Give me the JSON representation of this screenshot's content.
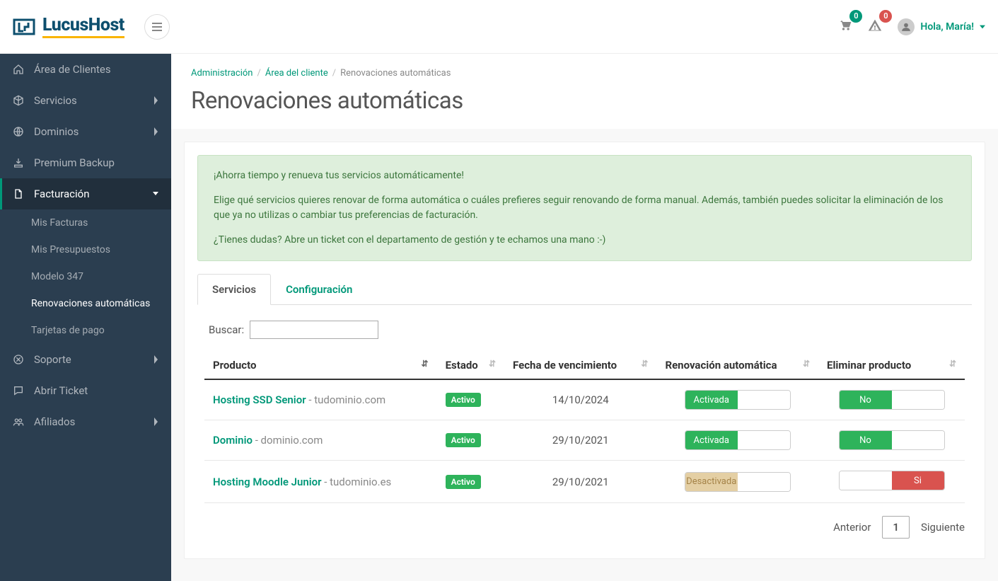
{
  "header": {
    "logo_text": "LucusHost",
    "cart_count": "0",
    "alert_count": "0",
    "greeting": "Hola, María!"
  },
  "sidebar": {
    "items": [
      {
        "label": "Área de Clientes",
        "icon": "home"
      },
      {
        "label": "Servicios",
        "icon": "cube",
        "chevron": true
      },
      {
        "label": "Dominios",
        "icon": "globe",
        "chevron": true
      },
      {
        "label": "Premium Backup",
        "icon": "download"
      },
      {
        "label": "Facturación",
        "icon": "file",
        "chevron": true,
        "active": true,
        "sub": [
          {
            "label": "Mis Facturas"
          },
          {
            "label": "Mis Presupuestos"
          },
          {
            "label": "Modelo 347"
          },
          {
            "label": "Renovaciones automáticas",
            "active": true
          },
          {
            "label": "Tarjetas de pago"
          }
        ]
      },
      {
        "label": "Soporte",
        "icon": "times-circle",
        "chevron": true
      },
      {
        "label": "Abrir Ticket",
        "icon": "comment"
      },
      {
        "label": "Afiliados",
        "icon": "users",
        "chevron": true
      }
    ]
  },
  "breadcrumb": {
    "items": [
      {
        "label": "Administración",
        "link": true
      },
      {
        "label": "Área del cliente",
        "link": true
      },
      {
        "label": "Renovaciones automáticas",
        "link": false
      }
    ]
  },
  "page_title": "Renovaciones automáticas",
  "alert": {
    "p1": "¡Ahorra tiempo y renueva tus servicios automáticamente!",
    "p2": "Elige qué servicios quieres renovar de forma automática o cuáles prefieres seguir renovando de forma manual. Además, también puedes solicitar la eliminación de los que ya no utilizas o cambiar tus preferencias de facturación.",
    "p3": "¿Tienes dudas? Abre un ticket con el departamento de gestión y te echamos una mano :-)"
  },
  "tabs": {
    "t1": "Servicios",
    "t2": "Configuración"
  },
  "search_label": "Buscar:",
  "table": {
    "headers": {
      "product": "Producto",
      "status": "Estado",
      "due": "Fecha de vencimiento",
      "renewal": "Renovación automática",
      "delete": "Eliminar producto"
    },
    "toggle_labels": {
      "activada": "Activada",
      "desactivada": "Desactivada",
      "no": "No",
      "si": "Si"
    },
    "rows": [
      {
        "product": "Hosting SSD Senior",
        "domain": "tudominio.com",
        "status": "Activo",
        "due": "14/10/2024",
        "renewal": "on",
        "delete": "no"
      },
      {
        "product": "Dominio",
        "domain": "dominio.com",
        "status": "Activo",
        "due": "29/10/2021",
        "renewal": "on",
        "delete": "no"
      },
      {
        "product": "Hosting Moodle Junior",
        "domain": "tudominio.es",
        "status": "Activo",
        "due": "29/10/2021",
        "renewal": "off",
        "delete": "si"
      }
    ]
  },
  "pagination": {
    "prev": "Anterior",
    "page": "1",
    "next": "Siguiente"
  }
}
